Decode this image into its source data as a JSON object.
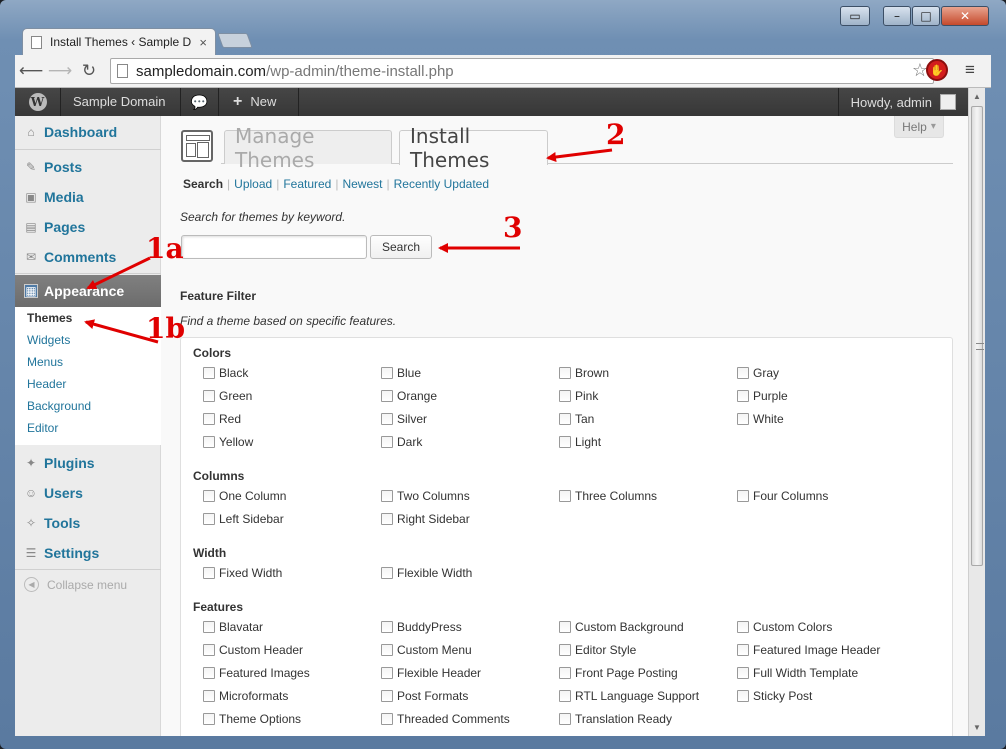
{
  "browser": {
    "tab_title": "Install Themes ‹ Sample D",
    "tab_close": "×",
    "url_host": "sampledomain.com",
    "url_path": "/wp-admin/theme-install.php",
    "window_controls": [
      "▭",
      "–",
      "□",
      "✕"
    ]
  },
  "adminbar": {
    "site_name": "Sample Domain",
    "new_label": "New",
    "new_icon": "+",
    "howdy": "Howdy, admin"
  },
  "sidebar": {
    "items": [
      {
        "label": "Dashboard",
        "icon": "⌂"
      },
      {
        "label": "Posts",
        "icon": "✎"
      },
      {
        "label": "Media",
        "icon": "▣"
      },
      {
        "label": "Pages",
        "icon": "▤"
      },
      {
        "label": "Comments",
        "icon": "✉"
      },
      {
        "label": "Appearance",
        "icon": "▦"
      },
      {
        "label": "Plugins",
        "icon": "✦"
      },
      {
        "label": "Users",
        "icon": "☺"
      },
      {
        "label": "Tools",
        "icon": "✧"
      },
      {
        "label": "Settings",
        "icon": "☰"
      }
    ],
    "submenu": [
      "Themes",
      "Widgets",
      "Menus",
      "Header",
      "Background",
      "Editor"
    ],
    "collapse_label": "Collapse menu"
  },
  "main": {
    "help_label": "Help",
    "tabs": [
      "Manage Themes",
      "Install Themes"
    ],
    "subnav": [
      "Search",
      "Upload",
      "Featured",
      "Newest",
      "Recently Updated"
    ],
    "search_hint": "Search for themes by keyword.",
    "search_value": "",
    "search_button": "Search",
    "feature_filter_title": "Feature Filter",
    "feature_filter_hint": "Find a theme based on specific features.",
    "groups": [
      {
        "title": "Colors",
        "options": [
          "Black",
          "Blue",
          "Brown",
          "Gray",
          "Green",
          "Orange",
          "Pink",
          "Purple",
          "Red",
          "Silver",
          "Tan",
          "White",
          "Yellow",
          "Dark",
          "Light"
        ]
      },
      {
        "title": "Columns",
        "options": [
          "One Column",
          "Two Columns",
          "Three Columns",
          "Four Columns",
          "Left Sidebar",
          "Right Sidebar"
        ]
      },
      {
        "title": "Width",
        "options": [
          "Fixed Width",
          "Flexible Width"
        ]
      },
      {
        "title": "Features",
        "options": [
          "Blavatar",
          "BuddyPress",
          "Custom Background",
          "Custom Colors",
          "Custom Header",
          "Custom Menu",
          "Editor Style",
          "Featured Image Header",
          "Featured Images",
          "Flexible Header",
          "Front Page Posting",
          "Full Width Template",
          "Microformats",
          "Post Formats",
          "RTL Language Support",
          "Sticky Post",
          "Theme Options",
          "Threaded Comments",
          "Translation Ready"
        ]
      }
    ]
  },
  "annotations": {
    "label_1a": "1a",
    "label_1b": "1b",
    "label_2": "2",
    "label_3": "3",
    "color": "#e00000"
  }
}
